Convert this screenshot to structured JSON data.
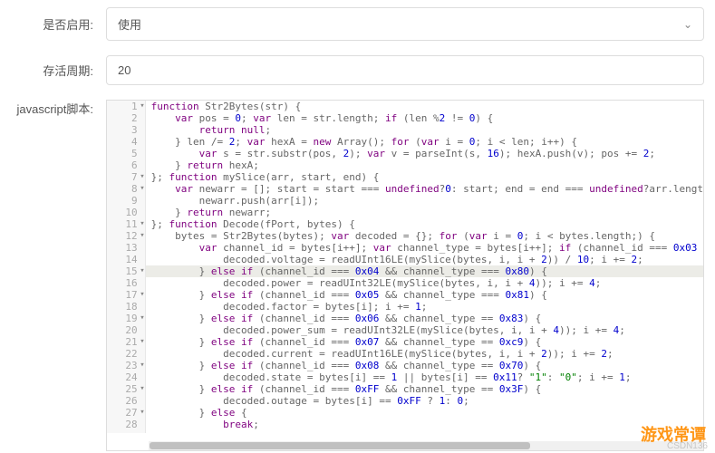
{
  "fields": {
    "enable_label": "是否启用:",
    "enable_value": "使用",
    "cycle_label": "存活周期:",
    "cycle_value": "20",
    "script_label": "javascript脚本:"
  },
  "code_lines": [
    {
      "n": 1,
      "fold": true,
      "seg": [
        [
          "kw",
          "function"
        ],
        [
          "op",
          " Str2Bytes(str) {"
        ]
      ]
    },
    {
      "n": 2,
      "seg": [
        [
          "op",
          "    "
        ],
        [
          "kw",
          "var"
        ],
        [
          "op",
          " pos = "
        ],
        [
          "num",
          "0"
        ],
        [
          "op",
          "; "
        ],
        [
          "kw",
          "var"
        ],
        [
          "op",
          " len = str.length; "
        ],
        [
          "kw",
          "if"
        ],
        [
          "op",
          " (len %"
        ],
        [
          "num",
          "2"
        ],
        [
          "op",
          " != "
        ],
        [
          "num",
          "0"
        ],
        [
          "op",
          ") {"
        ]
      ]
    },
    {
      "n": 3,
      "seg": [
        [
          "op",
          "        "
        ],
        [
          "kw",
          "return"
        ],
        [
          "op",
          " "
        ],
        [
          "kw",
          "null"
        ],
        [
          "op",
          ";"
        ]
      ]
    },
    {
      "n": 4,
      "seg": [
        [
          "op",
          "    } len /= "
        ],
        [
          "num",
          "2"
        ],
        [
          "op",
          "; "
        ],
        [
          "kw",
          "var"
        ],
        [
          "op",
          " hexA = "
        ],
        [
          "kw",
          "new"
        ],
        [
          "op",
          " Array(); "
        ],
        [
          "kw",
          "for"
        ],
        [
          "op",
          " ("
        ],
        [
          "kw",
          "var"
        ],
        [
          "op",
          " i = "
        ],
        [
          "num",
          "0"
        ],
        [
          "op",
          "; i < len; i++) {"
        ]
      ]
    },
    {
      "n": 5,
      "seg": [
        [
          "op",
          "        "
        ],
        [
          "kw",
          "var"
        ],
        [
          "op",
          " s = str.substr(pos, "
        ],
        [
          "num",
          "2"
        ],
        [
          "op",
          "); "
        ],
        [
          "kw",
          "var"
        ],
        [
          "op",
          " v = parseInt(s, "
        ],
        [
          "num",
          "16"
        ],
        [
          "op",
          "); hexA.push(v); pos += "
        ],
        [
          "num",
          "2"
        ],
        [
          "op",
          ";"
        ]
      ]
    },
    {
      "n": 6,
      "seg": [
        [
          "op",
          "    } "
        ],
        [
          "kw",
          "return"
        ],
        [
          "op",
          " hexA;"
        ]
      ]
    },
    {
      "n": 7,
      "fold": true,
      "seg": [
        [
          "op",
          "}; "
        ],
        [
          "kw",
          "function"
        ],
        [
          "op",
          " mySlice(arr, start, end) {"
        ]
      ]
    },
    {
      "n": 8,
      "fold": true,
      "seg": [
        [
          "op",
          "    "
        ],
        [
          "kw",
          "var"
        ],
        [
          "op",
          " newarr = []; start = start === "
        ],
        [
          "kw",
          "undefined"
        ],
        [
          "op",
          "?"
        ],
        [
          "num",
          "0"
        ],
        [
          "op",
          ": start; end = end === "
        ],
        [
          "kw",
          "undefined"
        ],
        [
          "op",
          "?arr.lengt"
        ]
      ]
    },
    {
      "n": 9,
      "seg": [
        [
          "op",
          "        newarr.push(arr[i]);"
        ]
      ]
    },
    {
      "n": 10,
      "seg": [
        [
          "op",
          "    } "
        ],
        [
          "kw",
          "return"
        ],
        [
          "op",
          " newarr;"
        ]
      ]
    },
    {
      "n": 11,
      "fold": true,
      "seg": [
        [
          "op",
          "}; "
        ],
        [
          "kw",
          "function"
        ],
        [
          "op",
          " Decode(fPort, bytes) {"
        ]
      ]
    },
    {
      "n": 12,
      "fold": true,
      "seg": [
        [
          "op",
          "    bytes = Str2Bytes(bytes); "
        ],
        [
          "kw",
          "var"
        ],
        [
          "op",
          " decoded = {}; "
        ],
        [
          "kw",
          "for"
        ],
        [
          "op",
          " ("
        ],
        [
          "kw",
          "var"
        ],
        [
          "op",
          " i = "
        ],
        [
          "num",
          "0"
        ],
        [
          "op",
          "; i < bytes.length;) {"
        ]
      ]
    },
    {
      "n": 13,
      "seg": [
        [
          "op",
          "        "
        ],
        [
          "kw",
          "var"
        ],
        [
          "op",
          " channel_id = bytes[i++]; "
        ],
        [
          "kw",
          "var"
        ],
        [
          "op",
          " channel_type = bytes[i++]; "
        ],
        [
          "kw",
          "if"
        ],
        [
          "op",
          " (channel_id === "
        ],
        [
          "num",
          "0x03"
        ]
      ]
    },
    {
      "n": 14,
      "seg": [
        [
          "op",
          "            decoded.voltage = readUInt16LE(mySlice(bytes, i, i + "
        ],
        [
          "num",
          "2"
        ],
        [
          "op",
          ")) / "
        ],
        [
          "num",
          "10"
        ],
        [
          "op",
          "; i += "
        ],
        [
          "num",
          "2"
        ],
        [
          "op",
          ";"
        ]
      ]
    },
    {
      "n": 15,
      "fold": true,
      "hl": true,
      "seg": [
        [
          "op",
          "        } "
        ],
        [
          "kw",
          "else"
        ],
        [
          "op",
          " "
        ],
        [
          "kw",
          "if"
        ],
        [
          "op",
          " (channel_id === "
        ],
        [
          "num",
          "0x04"
        ],
        [
          "op",
          " && channel_type === "
        ],
        [
          "num",
          "0x80"
        ],
        [
          "op",
          ") {"
        ]
      ]
    },
    {
      "n": 16,
      "seg": [
        [
          "op",
          "            decoded.power = readUInt32LE(mySlice(bytes, i, i + "
        ],
        [
          "num",
          "4"
        ],
        [
          "op",
          ")); i += "
        ],
        [
          "num",
          "4"
        ],
        [
          "op",
          ";"
        ]
      ]
    },
    {
      "n": 17,
      "fold": true,
      "seg": [
        [
          "op",
          "        } "
        ],
        [
          "kw",
          "else"
        ],
        [
          "op",
          " "
        ],
        [
          "kw",
          "if"
        ],
        [
          "op",
          " (channel_id === "
        ],
        [
          "num",
          "0x05"
        ],
        [
          "op",
          " && channel_type === "
        ],
        [
          "num",
          "0x81"
        ],
        [
          "op",
          ") {"
        ]
      ]
    },
    {
      "n": 18,
      "seg": [
        [
          "op",
          "            decoded.factor = bytes[i]; i += "
        ],
        [
          "num",
          "1"
        ],
        [
          "op",
          ";"
        ]
      ]
    },
    {
      "n": 19,
      "fold": true,
      "seg": [
        [
          "op",
          "        } "
        ],
        [
          "kw",
          "else"
        ],
        [
          "op",
          " "
        ],
        [
          "kw",
          "if"
        ],
        [
          "op",
          " (channel_id === "
        ],
        [
          "num",
          "0x06"
        ],
        [
          "op",
          " && channel_type == "
        ],
        [
          "num",
          "0x83"
        ],
        [
          "op",
          ") {"
        ]
      ]
    },
    {
      "n": 20,
      "seg": [
        [
          "op",
          "            decoded.power_sum = readUInt32LE(mySlice(bytes, i, i + "
        ],
        [
          "num",
          "4"
        ],
        [
          "op",
          ")); i += "
        ],
        [
          "num",
          "4"
        ],
        [
          "op",
          ";"
        ]
      ]
    },
    {
      "n": 21,
      "fold": true,
      "seg": [
        [
          "op",
          "        } "
        ],
        [
          "kw",
          "else"
        ],
        [
          "op",
          " "
        ],
        [
          "kw",
          "if"
        ],
        [
          "op",
          " (channel_id === "
        ],
        [
          "num",
          "0x07"
        ],
        [
          "op",
          " && channel_type == "
        ],
        [
          "num",
          "0xc9"
        ],
        [
          "op",
          ") {"
        ]
      ]
    },
    {
      "n": 22,
      "seg": [
        [
          "op",
          "            decoded.current = readUInt16LE(mySlice(bytes, i, i + "
        ],
        [
          "num",
          "2"
        ],
        [
          "op",
          ")); i += "
        ],
        [
          "num",
          "2"
        ],
        [
          "op",
          ";"
        ]
      ]
    },
    {
      "n": 23,
      "fold": true,
      "seg": [
        [
          "op",
          "        } "
        ],
        [
          "kw",
          "else"
        ],
        [
          "op",
          " "
        ],
        [
          "kw",
          "if"
        ],
        [
          "op",
          " (channel_id === "
        ],
        [
          "num",
          "0x08"
        ],
        [
          "op",
          " && channel_type == "
        ],
        [
          "num",
          "0x70"
        ],
        [
          "op",
          ") {"
        ]
      ]
    },
    {
      "n": 24,
      "seg": [
        [
          "op",
          "            decoded.state = bytes[i] == "
        ],
        [
          "num",
          "1"
        ],
        [
          "op",
          " || bytes[i] == "
        ],
        [
          "num",
          "0x11"
        ],
        [
          "op",
          "? "
        ],
        [
          "str",
          "\"1\""
        ],
        [
          "op",
          ": "
        ],
        [
          "str",
          "\"0\""
        ],
        [
          "op",
          "; i += "
        ],
        [
          "num",
          "1"
        ],
        [
          "op",
          ";"
        ]
      ]
    },
    {
      "n": 25,
      "fold": true,
      "seg": [
        [
          "op",
          "        } "
        ],
        [
          "kw",
          "else"
        ],
        [
          "op",
          " "
        ],
        [
          "kw",
          "if"
        ],
        [
          "op",
          " (channel_id === "
        ],
        [
          "num",
          "0xFF"
        ],
        [
          "op",
          " && channel_type == "
        ],
        [
          "num",
          "0x3F"
        ],
        [
          "op",
          ") {"
        ]
      ]
    },
    {
      "n": 26,
      "seg": [
        [
          "op",
          "            decoded.outage = bytes[i] == "
        ],
        [
          "num",
          "0xFF"
        ],
        [
          "op",
          " ? "
        ],
        [
          "num",
          "1"
        ],
        [
          "op",
          ": "
        ],
        [
          "num",
          "0"
        ],
        [
          "op",
          ";"
        ]
      ]
    },
    {
      "n": 27,
      "fold": true,
      "seg": [
        [
          "op",
          "        } "
        ],
        [
          "kw",
          "else"
        ],
        [
          "op",
          " {"
        ]
      ]
    },
    {
      "n": 28,
      "seg": [
        [
          "op",
          "            "
        ],
        [
          "kw",
          "break"
        ],
        [
          "op",
          ";"
        ]
      ]
    }
  ],
  "watermark": "游戏常谭",
  "watermark_sub": "CSDN136"
}
